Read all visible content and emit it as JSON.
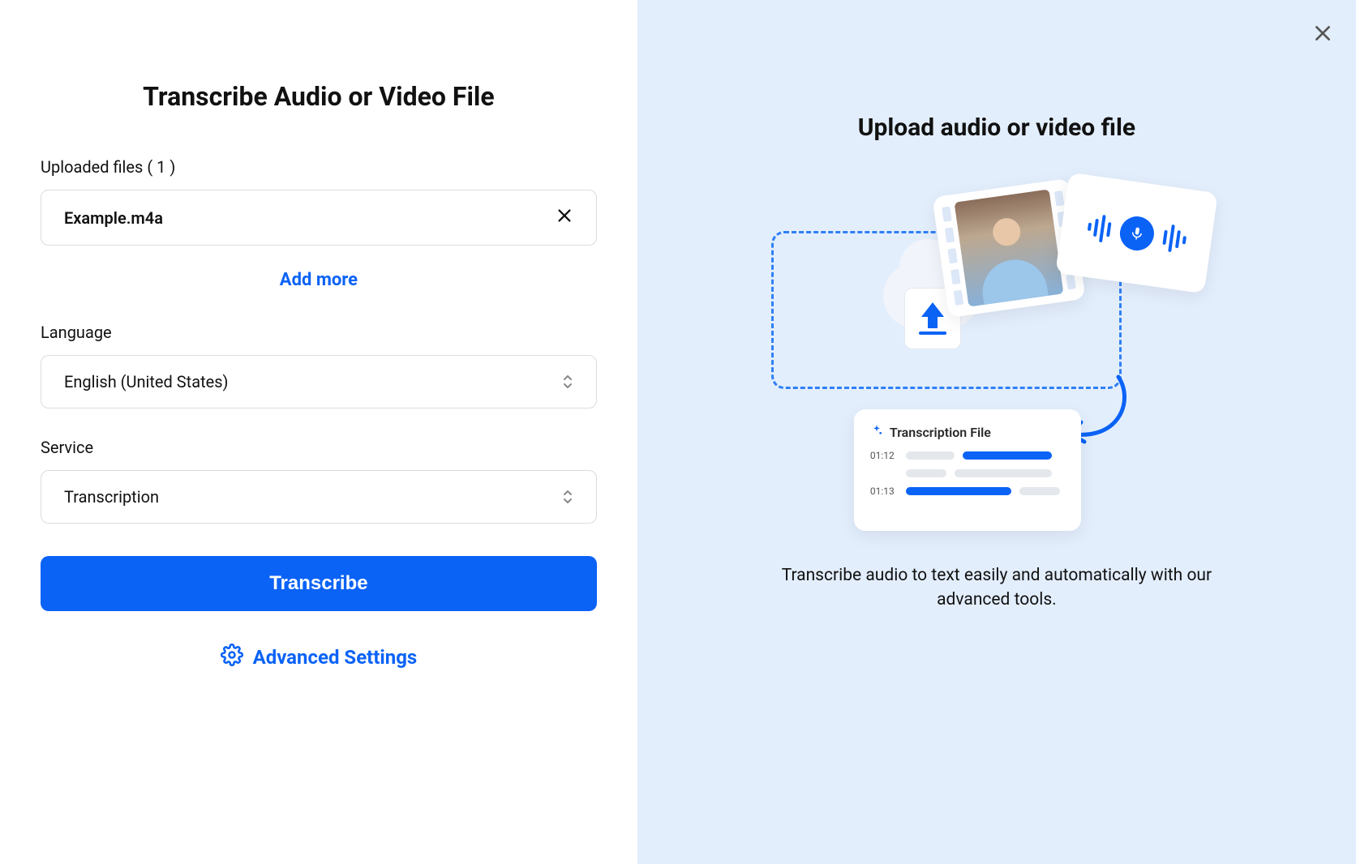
{
  "left": {
    "title": "Transcribe Audio or Video File",
    "uploaded_label_prefix": "Uploaded files",
    "uploaded_count": "( 1 )",
    "file_name": "Example.m4a",
    "add_more": "Add more",
    "language_label": "Language",
    "language_value": "English (United States)",
    "service_label": "Service",
    "service_value": "Transcription",
    "transcribe_btn": "Transcribe",
    "advanced_label": "Advanced Settings"
  },
  "right": {
    "title": "Upload audio or video file",
    "description": "Transcribe audio to text easily and automatically with our advanced tools.",
    "illustration": {
      "transcript_title": "Transcription File",
      "time1": "01:12",
      "time2": "01:13"
    }
  }
}
